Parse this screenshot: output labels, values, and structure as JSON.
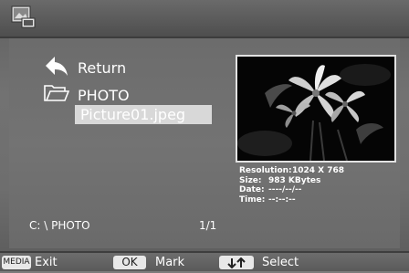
{
  "header": {
    "app_icon": "photo-viewer-icon"
  },
  "browser": {
    "return_label": "Return",
    "folder_label": "PHOTO",
    "selected_file": "Picture01.jpeg"
  },
  "info": {
    "resolution_key": "Resolution:",
    "resolution_val": "1024 X 768",
    "size_key": "Size:",
    "size_val": "983 KBytes",
    "date_key": "Date:",
    "date_val": "----/--/--",
    "time_key": "Time:",
    "time_val": "--:--:--"
  },
  "status": {
    "path": "C: \\ PHOTO",
    "page": "1/1"
  },
  "footer": {
    "media_key": "MEDIA",
    "exit_label": "Exit",
    "ok_key": "OK",
    "mark_label": "Mark",
    "select_label": "Select"
  },
  "colors": {
    "background": "#727272",
    "highlight": "#d8d8d8",
    "preview_border": "#e2e2e2"
  }
}
